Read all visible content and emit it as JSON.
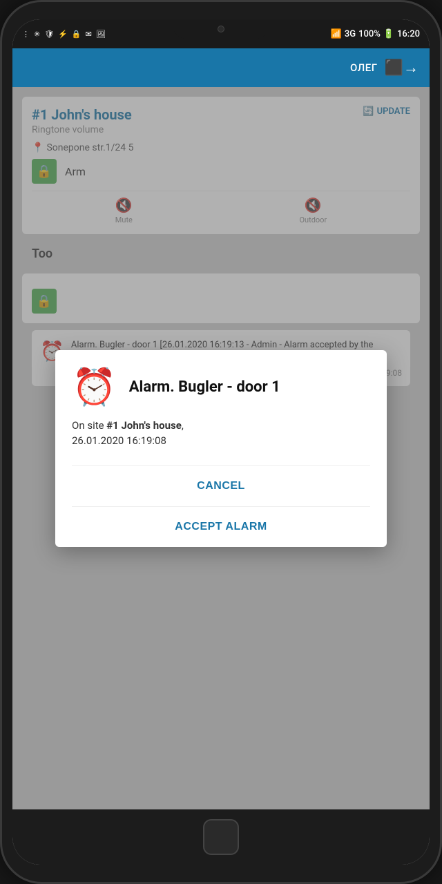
{
  "statusBar": {
    "time": "16:20",
    "battery": "100%",
    "signal": "3G"
  },
  "header": {
    "username": "ОЛЕГ",
    "logoutIcon": "→"
  },
  "backgroundContent": {
    "siteCard": {
      "name": "#1 John's house",
      "subtitle": "Ringtone volume",
      "address": "Sonepone str.1/24 5",
      "updateButton": "UPDATE",
      "armLabel": "Arm"
    },
    "controls": {
      "mute": "Mute",
      "outdoor": "Outdoor"
    },
    "sectionTitle": "Too",
    "logEntry": {
      "text": "Alarm. Bugler - door 1 [26.01.2020 16:19:13 - Admin - Alarm accepted by the operator.Реальная тревога]",
      "timestamp": "26.01.2020 16:19:08"
    }
  },
  "dialog": {
    "alarmIconUnicode": "⏰",
    "title": "Alarm. Bugler - door 1",
    "bodyPrefix": "On site ",
    "siteName": "#1 John's house",
    "bodyDate": ",\n26.01.2020 16:19:08",
    "cancelButton": "CANCEL",
    "acceptButton": "ACCEPT ALARM"
  }
}
